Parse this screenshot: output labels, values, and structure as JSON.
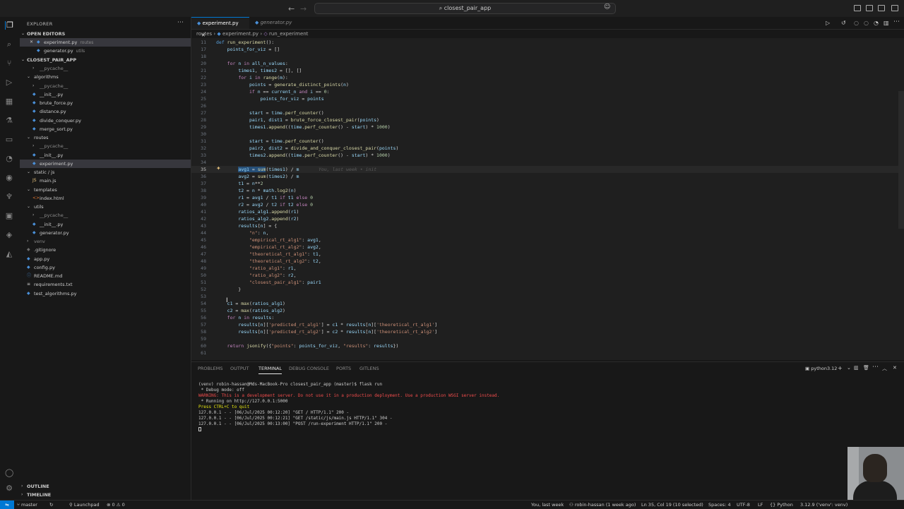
{
  "titlebar": {
    "search_text": "closest_pair_app",
    "back_icon": "arrow-left-icon",
    "forward_icon": "arrow-right-icon"
  },
  "explorer": {
    "title": "EXPLORER",
    "open_editors_label": "OPEN EDITORS",
    "open_editors": [
      {
        "name": "experiment.py",
        "desc": "routes"
      },
      {
        "name": "generator.py",
        "desc": "utils"
      }
    ],
    "project_label": "CLOSEST_PAIR_APP",
    "tree": [
      {
        "name": "__pycache__"
      },
      {
        "name": "algorithms"
      },
      {
        "name": "__pycache__"
      },
      {
        "name": "__init__.py"
      },
      {
        "name": "brute_force.py"
      },
      {
        "name": "distance.py"
      },
      {
        "name": "divide_conquer.py"
      },
      {
        "name": "merge_sort.py"
      },
      {
        "name": "routes"
      },
      {
        "name": "__pycache__"
      },
      {
        "name": "__init__.py"
      },
      {
        "name": "experiment.py"
      },
      {
        "name": "static / js"
      },
      {
        "name": "main.js"
      },
      {
        "name": "templates"
      },
      {
        "name": "index.html"
      },
      {
        "name": "utils"
      },
      {
        "name": "__pycache__"
      },
      {
        "name": "__init__.py"
      },
      {
        "name": "generator.py"
      },
      {
        "name": "venv"
      },
      {
        "name": ".gitignore"
      },
      {
        "name": "app.py"
      },
      {
        "name": "config.py"
      },
      {
        "name": "README.md"
      },
      {
        "name": "requirements.txt"
      },
      {
        "name": "test_algorithms.py"
      }
    ],
    "outline_label": "OUTLINE",
    "timeline_label": "TIMELINE"
  },
  "tabs": [
    {
      "label": "experiment.py"
    },
    {
      "label": "generator.py"
    }
  ],
  "breadcrumb": {
    "folder": "routes",
    "file": "experiment.py",
    "symbol": "run_experiment"
  },
  "code": [
    {
      "n": "11",
      "t": "def run_experiment():"
    },
    {
      "n": "17",
      "t": "    points_for_viz = []"
    },
    {
      "n": "18",
      "t": ""
    },
    {
      "n": "20",
      "t": "    for n in all_n_values:"
    },
    {
      "n": "21",
      "t": "        times1, times2 = [], []"
    },
    {
      "n": "22",
      "t": "        for i in range(m):"
    },
    {
      "n": "23",
      "t": "            points = generate_distinct_points(n)"
    },
    {
      "n": "24",
      "t": "            if n == current_n and i == 0:"
    },
    {
      "n": "25",
      "t": "                points_for_viz = points"
    },
    {
      "n": "26",
      "t": ""
    },
    {
      "n": "27",
      "t": "            start = time.perf_counter()"
    },
    {
      "n": "28",
      "t": "            pair1, dist1 = brute_force_closest_pair(points)"
    },
    {
      "n": "29",
      "t": "            times1.append((time.perf_counter() - start) * 1000)"
    },
    {
      "n": "30",
      "t": ""
    },
    {
      "n": "31",
      "t": "            start = time.perf_counter()"
    },
    {
      "n": "32",
      "t": "            pair2, dist2 = divide_and_conquer_closest_pair(points)"
    },
    {
      "n": "33",
      "t": "            times2.append((time.perf_counter() - start) * 1000)"
    },
    {
      "n": "34",
      "t": ""
    },
    {
      "n": "35",
      "t": "        avg1 = sum(times1) / m"
    },
    {
      "n": "36",
      "t": "        avg2 = sum(times2) / m"
    },
    {
      "n": "37",
      "t": "        t1 = n**2"
    },
    {
      "n": "38",
      "t": "        t2 = n * math.log2(n)"
    },
    {
      "n": "39",
      "t": "        r1 = avg1 / t1 if t1 else 0"
    },
    {
      "n": "40",
      "t": "        r2 = avg2 / t2 if t2 else 0"
    },
    {
      "n": "41",
      "t": "        ratios_alg1.append(r1)"
    },
    {
      "n": "42",
      "t": "        ratios_alg2.append(r2)"
    },
    {
      "n": "43",
      "t": "        results[n] = {"
    },
    {
      "n": "44",
      "t": "            \"n\": n,"
    },
    {
      "n": "45",
      "t": "            \"empirical_rt_alg1\": avg1,"
    },
    {
      "n": "46",
      "t": "            \"empirical_rt_alg2\": avg2,"
    },
    {
      "n": "47",
      "t": "            \"theoretical_rt_alg1\": t1,"
    },
    {
      "n": "48",
      "t": "            \"theoretical_rt_alg2\": t2,"
    },
    {
      "n": "49",
      "t": "            \"ratio_alg1\": r1,"
    },
    {
      "n": "50",
      "t": "            \"ratio_alg2\": r2,"
    },
    {
      "n": "51",
      "t": "            \"closest_pair_alg1\": pair1"
    },
    {
      "n": "52",
      "t": "        }"
    },
    {
      "n": "53",
      "t": ""
    },
    {
      "n": "54",
      "t": "    c1 = max(ratios_alg1)"
    },
    {
      "n": "55",
      "t": "    c2 = max(ratios_alg2)"
    },
    {
      "n": "56",
      "t": "    for n in results:"
    },
    {
      "n": "57",
      "t": "        results[n]['predicted_rt_alg1'] = c1 * results[n]['theoretical_rt_alg1']"
    },
    {
      "n": "58",
      "t": "        results[n]['predicted_rt_alg2'] = c2 * results[n]['theoretical_rt_alg2']"
    },
    {
      "n": "59",
      "t": ""
    },
    {
      "n": "60",
      "t": "    return jsonify({\"points\": points_for_viz, \"results\": results})"
    },
    {
      "n": "61",
      "t": ""
    }
  ],
  "blame_text": "You, last week • init",
  "panel": {
    "tabs": [
      "PROBLEMS",
      "OUTPUT",
      "TERMINAL",
      "DEBUG CONSOLE",
      "PORTS",
      "GITLENS"
    ],
    "shell_label": "python3.12",
    "terminal": [
      {
        "t": "(venv) robin-hassan@Mds-MacBook-Pro closest_pair_app (master)$ flask run",
        "c": "#cccccc"
      },
      {
        "t": " * Debug mode: off",
        "c": "#cccccc"
      },
      {
        "t": "WARNING: This is a development server. Do not use it in a production deployment. Use a production WSGI server instead.",
        "c": "#f14c4c"
      },
      {
        "t": " * Running on http://127.0.0.1:5000",
        "c": "#cccccc"
      },
      {
        "t": "Press CTRL+C to quit",
        "c": "#e5e510"
      },
      {
        "t": "127.0.0.1 - - [06/Jul/2025 00:12:20] \"GET / HTTP/1.1\" 200 -",
        "c": "#cccccc"
      },
      {
        "t": "127.0.0.1 - - [06/Jul/2025 00:12:21] \"GET /static/js/main.js HTTP/1.1\" 304 -",
        "c": "#cccccc"
      },
      {
        "t": "127.0.0.1 - - [06/Jul/2025 00:13:00] \"POST /run-experiment HTTP/1.1\" 200 -",
        "c": "#cccccc"
      }
    ]
  },
  "status": {
    "branch": "master",
    "launchpad": "Launchpad",
    "problems": "0",
    "warnings": "0",
    "blame": "You, last week",
    "author": "robin-hassan (1 week ago)",
    "position": "Ln 35, Col 19 (10 selected)",
    "spaces": "Spaces: 4",
    "encoding": "UTF-8",
    "eol": "LF",
    "language": "Python",
    "interpreter": "3.12.9 ('venv': venv)"
  },
  "colors": {
    "accent": "#0078d4",
    "keyword": "#569cd6",
    "control": "#c586c0",
    "string": "#ce9178",
    "function": "#dcdcaa",
    "number": "#b5cea8"
  }
}
